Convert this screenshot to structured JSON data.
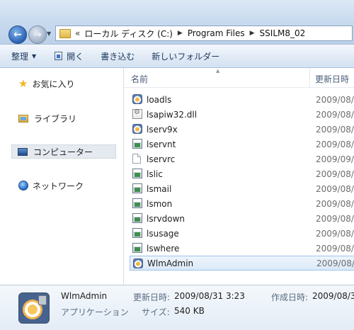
{
  "address": {
    "overflow_chevron": "«",
    "crumbs": [
      "ローカル ディスク (C:)",
      "Program Files",
      "SSILM8_02"
    ]
  },
  "toolbar": {
    "organize": "整理",
    "open": "開く",
    "burn": "書き込む",
    "new_folder": "新しいフォルダー"
  },
  "nav": {
    "favorites": "お気に入り",
    "libraries": "ライブラリ",
    "computer": "コンピューター",
    "network": "ネットワーク"
  },
  "columns": {
    "name": "名前",
    "date": "更新日時"
  },
  "files": [
    {
      "name": "loadls",
      "date": "2009/08/3",
      "icon": "app-icon"
    },
    {
      "name": "lsapiw32.dll",
      "date": "2009/08/3",
      "icon": "dll-icon"
    },
    {
      "name": "lserv9x",
      "date": "2009/08/3",
      "icon": "app-icon"
    },
    {
      "name": "lservnt",
      "date": "2009/08/3",
      "icon": "console-icon"
    },
    {
      "name": "lservrc",
      "date": "2009/09/0",
      "icon": "blank-file-icon"
    },
    {
      "name": "lslic",
      "date": "2009/08/3",
      "icon": "console-icon"
    },
    {
      "name": "lsmail",
      "date": "2009/08/3",
      "icon": "console-icon"
    },
    {
      "name": "lsmon",
      "date": "2009/08/3",
      "icon": "console-icon"
    },
    {
      "name": "lsrvdown",
      "date": "2009/08/3",
      "icon": "console-icon"
    },
    {
      "name": "lsusage",
      "date": "2009/08/3",
      "icon": "console-icon"
    },
    {
      "name": "lswhere",
      "date": "2009/08/3",
      "icon": "console-icon"
    },
    {
      "name": "WlmAdmin",
      "date": "2009/08/3",
      "icon": "app-icon",
      "selected": true
    }
  ],
  "details": {
    "name": "WlmAdmin",
    "type": "アプリケーション",
    "modified_label": "更新日時:",
    "modified_value": "2009/08/31 3:23",
    "created_label": "作成日時:",
    "created_value": "2009/08/31",
    "size_label": "サイズ:",
    "size_value": "540 KB"
  },
  "colors": {
    "accent": "#2a63b4",
    "selection_border": "#9ec3ea",
    "toolbar_text": "#1e395b"
  }
}
